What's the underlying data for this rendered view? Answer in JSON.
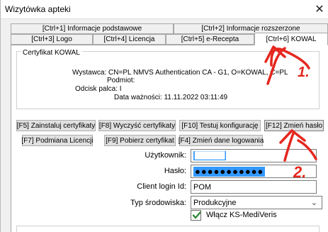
{
  "window": {
    "title": "Wizytówka apteki",
    "close_glyph": "✕"
  },
  "tabs_row1": [
    {
      "label": "[Ctrl+1] Informacje podstawowe"
    },
    {
      "label": "[Ctrl+2] Informacje rozszerzone"
    }
  ],
  "tabs_row2": [
    {
      "label": "[Ctrl+3] Logo"
    },
    {
      "label": "[Ctrl+4] Licencja"
    },
    {
      "label": "[Ctrl+5] e-Recepta"
    },
    {
      "label": "[Ctrl+6] KOWAL",
      "active": true
    }
  ],
  "certificate": {
    "legend": "Certyfikat KOWAL",
    "issuer": "Wystawca: CN=PL NMVS Authentication CA - G1, O=KOWAL, C=PL",
    "subject": "Podmiot:",
    "fingerprint": "Odcisk palca: I",
    "validity": "Data ważności: 11.11.2022 03:11:49"
  },
  "buttons_row1": {
    "install": "[F5] Zainstaluj certyfikaty",
    "clear": "[F8] Wyczyść certyfikaty",
    "test": "[F10] Testuj konfigurację",
    "change_password": "[F12] Zmień hasło"
  },
  "buttons_row2": {
    "license": "[F7] Podmiana Licencji",
    "download": "[F9] Pobierz certyfikat",
    "change_login": "[F4] Zmień dane logowania"
  },
  "form": {
    "user_label": "Użytkownik:",
    "user_value": "▇▇▇▇▇",
    "password_label": "Hasło:",
    "password_value": "●●●●●●●●●●●",
    "client_label": "Client login Id:",
    "client_value": "POM",
    "env_label": "Typ środowiska:",
    "env_value": "Produkcyjne",
    "env_arrow": "⌄",
    "mediveris_label": "Włącz KS-MediVeris",
    "mediveris_checked": true
  },
  "annotations": {
    "color": "#e5271e",
    "marker1": "1.",
    "marker2": "2."
  }
}
